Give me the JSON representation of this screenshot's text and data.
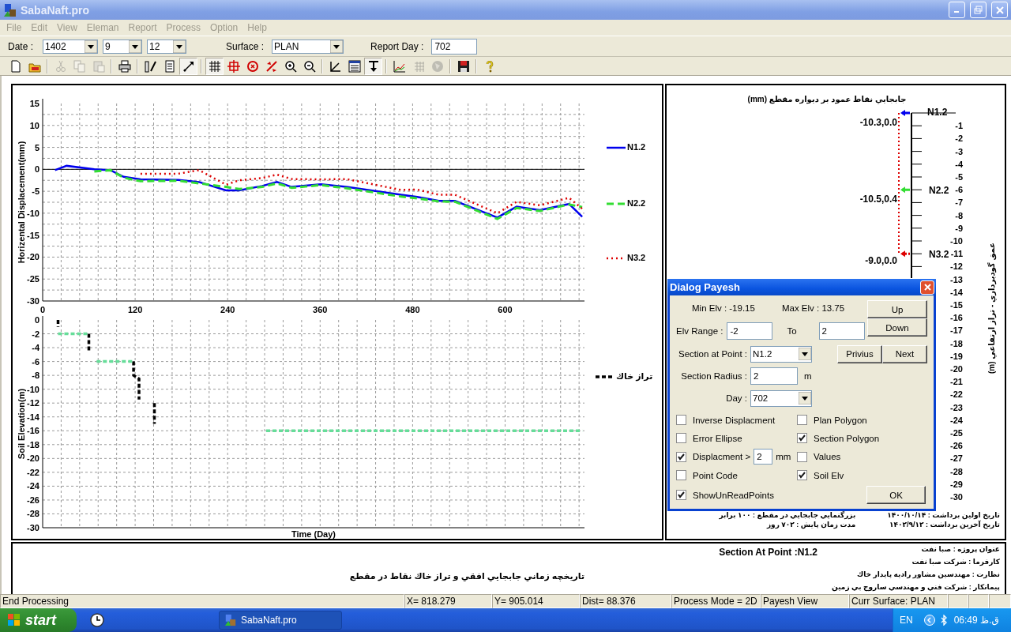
{
  "window": {
    "title": "SabaNaft.pro"
  },
  "menu": [
    {
      "label": "File",
      "disabled": true
    },
    {
      "label": "Edit",
      "disabled": true
    },
    {
      "label": "View",
      "disabled": true
    },
    {
      "label": "Eleman",
      "disabled": true
    },
    {
      "label": "Report",
      "disabled": true
    },
    {
      "label": "Process",
      "disabled": true
    },
    {
      "label": "Option",
      "disabled": true
    },
    {
      "label": "Help",
      "disabled": true
    }
  ],
  "date_bar": {
    "date_label": "Date :",
    "year": "1402",
    "month": "9",
    "day": "12",
    "surface_label": "Surface :",
    "surface": "PLAN",
    "report_day_label": "Report Day :",
    "report_day": "702"
  },
  "toolbar": [
    {
      "disabled": false,
      "pressed": false
    },
    {
      "disabled": false,
      "pressed": false
    },
    {
      "disabled": true,
      "pressed": false
    },
    {
      "disabled": true,
      "pressed": false
    },
    {
      "disabled": true,
      "pressed": false
    },
    {
      "disabled": false,
      "pressed": false
    },
    {
      "disabled": false,
      "pressed": false
    },
    {
      "disabled": false,
      "pressed": false
    },
    {
      "disabled": false,
      "pressed": true
    },
    {
      "disabled": false,
      "pressed": true
    },
    {
      "disabled": false,
      "pressed": false
    },
    {
      "disabled": false,
      "pressed": false
    },
    {
      "disabled": false,
      "pressed": false
    },
    {
      "disabled": false,
      "pressed": false
    },
    {
      "disabled": false,
      "pressed": false
    },
    {
      "disabled": false,
      "pressed": false
    },
    {
      "disabled": false,
      "pressed": false
    },
    {
      "disabled": false,
      "pressed": true
    },
    {
      "disabled": false,
      "pressed": false
    },
    {
      "disabled": true,
      "pressed": false
    },
    {
      "disabled": true,
      "pressed": false
    },
    {
      "disabled": false,
      "pressed": false
    },
    {
      "disabled": false,
      "pressed": false
    }
  ],
  "displacement_chart": {
    "chart_data": {
      "type": "line",
      "grid": true,
      "legend": "right",
      "ylabel": "Horizental Displacement(mm)",
      "x": [
        16,
        31,
        67,
        88,
        105,
        127,
        176,
        203,
        238,
        255,
        285,
        304,
        323,
        361,
        394,
        465,
        486,
        514,
        535,
        590,
        615,
        645,
        683,
        700
      ],
      "xlim": [
        0,
        703
      ],
      "ylim": [
        -30,
        15
      ],
      "xticks": [
        0,
        120,
        240,
        360,
        480,
        600
      ],
      "yticks": [
        15,
        10,
        5,
        0,
        -5,
        -10,
        -15,
        -20,
        -25,
        -30
      ],
      "series": [
        {
          "name": "N1.2",
          "color": "#0000ee",
          "line_style": "solid",
          "values": [
            -0.2,
            0.8,
            0,
            -0.2,
            -1.7,
            -2.3,
            -2.4,
            -2.9,
            -4.8,
            -4.8,
            -3.8,
            -2.9,
            -4,
            -3.4,
            -4,
            -5.8,
            -6.3,
            -7.2,
            -7.2,
            -11,
            -8.5,
            -9.3,
            -7.9,
            -10.8
          ]
        },
        {
          "name": "N2.2",
          "color": "#33dd33",
          "line_style": "dashed",
          "values": [
            null,
            null,
            -0.5,
            -0.2,
            -1.9,
            -2.7,
            -2.6,
            -3.2,
            -4,
            -4.5,
            -4,
            -3.2,
            -4.2,
            -3.6,
            -4.3,
            -6.2,
            -6.6,
            -7.3,
            -7.4,
            -11.3,
            -8.8,
            -9.5,
            -8,
            -8.6
          ]
        },
        {
          "name": "N3.2",
          "color": "#dd0000",
          "line_style": "dotted",
          "values": [
            null,
            null,
            null,
            null,
            null,
            -1,
            -1,
            -0.2,
            -3.5,
            -2.5,
            -2,
            -1.2,
            -2.2,
            -2.3,
            -2.2,
            -4.7,
            -4.6,
            -5.8,
            -5.8,
            -10,
            -7.4,
            -8.2,
            -6.5,
            -9
          ]
        }
      ]
    }
  },
  "soil_chart": {
    "chart_data": {
      "type": "line",
      "grid": true,
      "legend": "right",
      "xlabel": "Time (Day)",
      "ylabel": "Soil Elevation(m)",
      "x": [
        20,
        20,
        20,
        60,
        60,
        70,
        118,
        118,
        125,
        125,
        290,
        700,
        145,
        145
      ],
      "xlim": [
        0,
        703
      ],
      "ylim": [
        -30,
        0
      ],
      "yticks": [
        0,
        -2,
        -4,
        -6,
        -8,
        -10,
        -12,
        -14,
        -16,
        -18,
        -20,
        -22,
        -24,
        -26,
        -28,
        -30
      ],
      "series": [
        {
          "name": "تراز خاك",
          "color": "#000000",
          "line_style": "dashed",
          "values": [
            0,
            -1,
            null,
            -2,
            -4.5,
            null,
            -6,
            -8,
            -8.5,
            -11.5,
            null,
            null,
            -12,
            -15
          ]
        },
        {
          "color": "#66dd99",
          "line_style": "dashed",
          "values": [
            null,
            null,
            -2,
            -2,
            null,
            -6,
            -6,
            null,
            null,
            null,
            -16,
            -16,
            null,
            null
          ]
        }
      ]
    }
  },
  "section_panel": {
    "title": "جابجايي نقاط عمود بر ديواره مقطع (mm)",
    "points": [
      {
        "name": "N1.2",
        "reading": "-10.3,0.0",
        "color": "#0000ee"
      },
      {
        "name": "N2.2",
        "reading": "-10.5,0.4",
        "color": "#33dd33"
      },
      {
        "name": "N3.2",
        "reading": "-9.0,0.0",
        "color": "#dd0000"
      }
    ],
    "depth_labels": [
      "-1",
      "-2",
      "-3",
      "-4",
      "-5",
      "-6",
      "-7",
      "-8",
      "-9",
      "-10",
      "-11",
      "-12",
      "-13",
      "-14",
      "-15",
      "-16",
      "-17",
      "-18",
      "-19",
      "-20",
      "-21",
      "-22",
      "-23",
      "-24",
      "-25",
      "-26",
      "-27",
      "-28",
      "-29",
      "-30"
    ],
    "axis_label": "عمق گودبرداري - تراز ارتفاعي (m)",
    "notes": [
      [
        "تاريخ اولين برداشت : ۱۴۰۰/۱۰/۱۴",
        "تاريخ آخرين برداشت : ۱۴۰۲/۹/۱۲"
      ],
      [
        "بزرگنمايي جابجايي در مقطع : ۱۰۰ برابر",
        "مدت زمان پايش : ۷۰۲ روز"
      ]
    ]
  },
  "dialog": {
    "title": "Dialog Payesh",
    "min_elv": "Min Elv : -19.15",
    "max_elv": "Max Elv : 13.75",
    "elv_range": {
      "label": "Elv Range :",
      "from": "-2",
      "to_label": "To",
      "to": "2"
    },
    "nav_buttons": [
      "Up",
      "Down"
    ],
    "section_point": {
      "label": "Section at Point :",
      "value": "N1.2"
    },
    "point_buttons": [
      "Privius",
      "Next"
    ],
    "section_radius": {
      "label": "Section Radius :",
      "value": "2",
      "unit": "m"
    },
    "day": {
      "label": "Day :",
      "value": "702"
    },
    "options": [
      {
        "kind": "checkbox",
        "label": "Inverse Displacment",
        "checked": false
      },
      {
        "kind": "checkbox",
        "label": "Plan Polygon",
        "checked": false
      },
      {
        "kind": "checkbox",
        "label": "Error Ellipse",
        "checked": false
      },
      {
        "kind": "checkbox",
        "label": "Section Polygon",
        "checked": true
      },
      {
        "kind": "threshold",
        "label": "Displacment >",
        "checked": true,
        "value": "2",
        "unit": "mm"
      },
      {
        "kind": "checkbox",
        "label": "Values",
        "checked": false
      },
      {
        "kind": "checkbox",
        "label": "Point Code",
        "checked": false
      },
      {
        "kind": "checkbox",
        "label": "Soil Elv",
        "checked": true
      },
      {
        "kind": "checkbox",
        "label": "ShowUnReadPoints",
        "checked": true
      }
    ],
    "ok": "OK"
  },
  "info_panel": {
    "section": "Section At Point :N1.2",
    "title": "تاريخچه زماني جابجايي افقي و تراز خاك نقاط در مقطع",
    "lines": [
      "عنوان پروژه : صبا نفت",
      "كارفرما : شركت صبا نفت",
      "نظارت : مهندسين مشاور راديه پايدار خاك",
      "پيمانكار : شركت فني و مهندسي ساروج بي زمين"
    ]
  },
  "status_bar": [
    "End Processing",
    "X= 818.279",
    "Y= 905.014",
    "Dist= 88.376",
    "Process Mode = 2D",
    "Payesh View",
    "Curr Surface: PLAN"
  ],
  "taskbar": {
    "start": "start",
    "task": "SabaNaft.pro",
    "language": "EN",
    "clock": "06:49 ق.ظ"
  }
}
